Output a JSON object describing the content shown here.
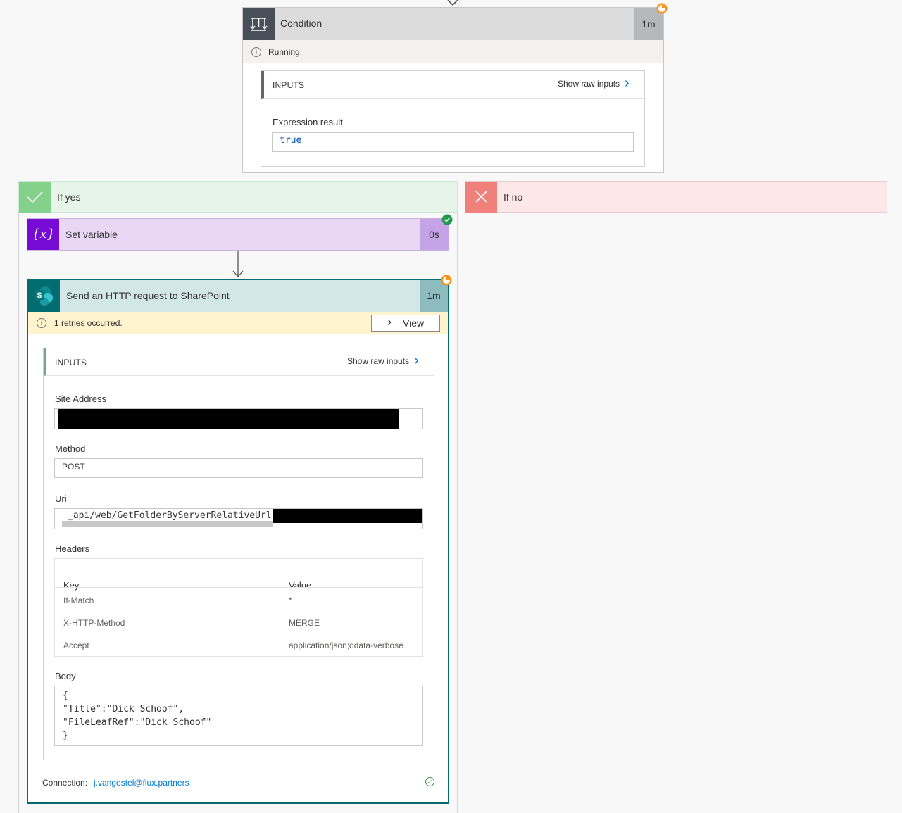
{
  "colors": {
    "condition_icon": "#484f58",
    "setvar_icon": "#770bd6",
    "sharepoint_icon": "#036c70",
    "yes": "#84d18c",
    "no": "#f0817a",
    "running_badge": "#f7931e",
    "success_badge": "#1e9b4a",
    "link": "#0078d4"
  },
  "condition": {
    "title": "Condition",
    "duration": "1m",
    "icon": "condition-icon",
    "status": "Running.",
    "inputs_label": "INPUTS",
    "show_raw": "Show raw inputs",
    "expr_label": "Expression result",
    "expr_value": "true"
  },
  "branches": {
    "yes_label": "If yes",
    "no_label": "If no"
  },
  "set_variable": {
    "title": "Set variable",
    "duration": "0s",
    "icon_glyph": "{x}"
  },
  "http_action": {
    "title": "Send an HTTP request to SharePoint",
    "duration": "1m",
    "icon_glyph": "S",
    "status": "1 retries occurred.",
    "view_label": "View",
    "inputs_label": "INPUTS",
    "show_raw": "Show raw inputs",
    "site_label": "Site Address",
    "method_label": "Method",
    "method_value": "POST",
    "uri_label": "Uri",
    "uri_value": "_api/web/GetFolderByServerRelativeUrl('",
    "headers_label": "Headers",
    "headers_cols": [
      "Key",
      "Value"
    ],
    "headers_rows": [
      {
        "key": "If-Match",
        "value": "*"
      },
      {
        "key": "X-HTTP-Method",
        "value": "MERGE"
      },
      {
        "key": "Accept",
        "value": "application/json;odata-verbose"
      }
    ],
    "body_label": "Body",
    "body_value": "{\n\"Title\":\"Dick Schoof\",\n\"FileLeafRef\":\"Dick Schoof\"\n}",
    "connection_label": "Connection:",
    "connection_value": "j.vangestel@flux.partners"
  }
}
